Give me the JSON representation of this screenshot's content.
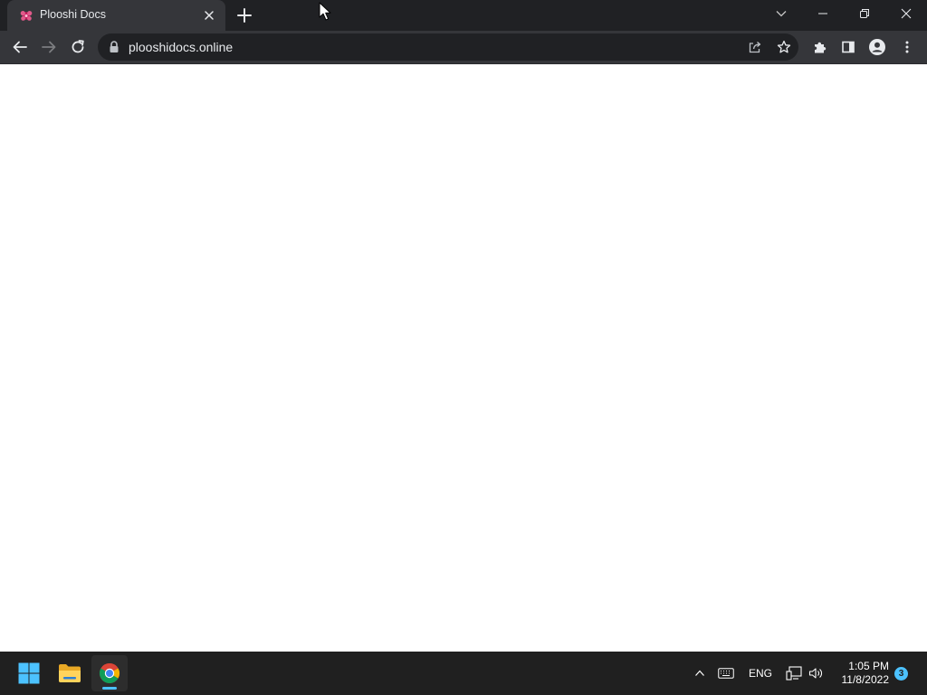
{
  "browser": {
    "tab": {
      "title": "Plooshi Docs",
      "favicon": "plooshi-favicon"
    },
    "address_bar": {
      "url": "plooshidocs.online"
    }
  },
  "taskbar": {
    "apps": [
      {
        "name": "Start",
        "icon": "windows-start-icon"
      },
      {
        "name": "File Explorer",
        "icon": "folder-icon"
      },
      {
        "name": "Google Chrome",
        "icon": "chrome-icon",
        "active": true
      }
    ],
    "tray": {
      "language": "ENG",
      "time": "1:05 PM",
      "date": "11/8/2022",
      "notifications": "3"
    }
  },
  "colors": {
    "tabstrip": "#202124",
    "toolbar": "#35363a",
    "omnibox": "#202124",
    "taskbar": "#202020",
    "accent": "#4cc2ff"
  }
}
